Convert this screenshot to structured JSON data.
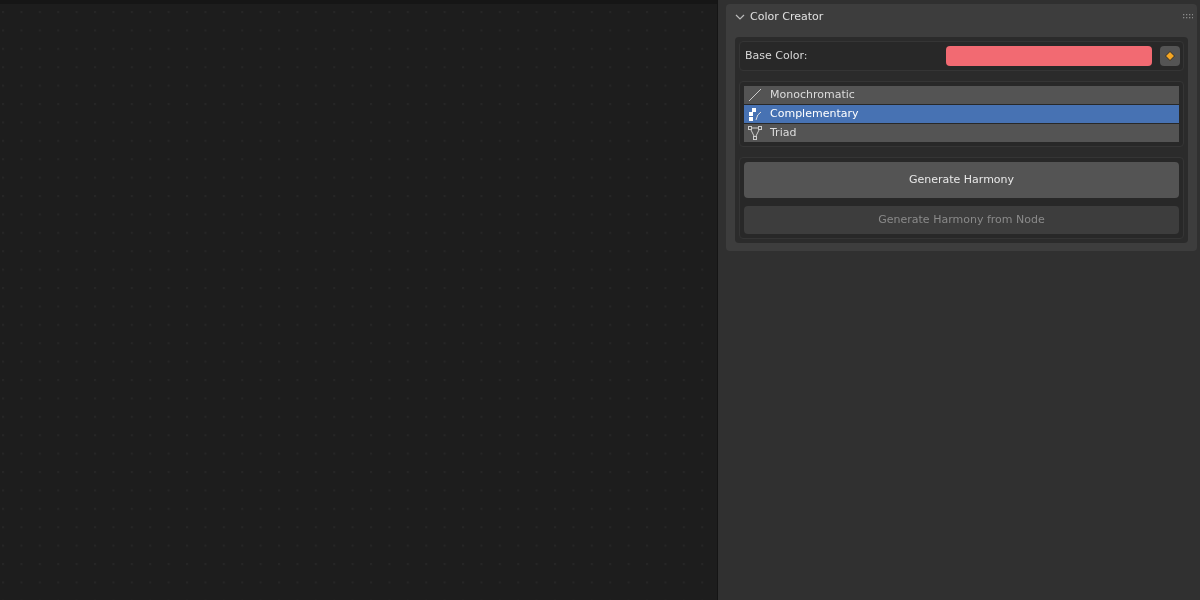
{
  "panel": {
    "title": "Color Creator",
    "expanded": true
  },
  "base_color": {
    "label": "Base Color:",
    "color": "#f26a72"
  },
  "harmonies": [
    {
      "kind": "line",
      "label": "Monochromatic",
      "selected": false
    },
    {
      "kind": "squares",
      "label": "Complementary",
      "selected": true
    },
    {
      "kind": "triangle",
      "label": "Triad",
      "selected": false
    }
  ],
  "buttons": [
    {
      "label": "Generate Harmony",
      "disabled": false
    },
    {
      "label": "Generate Harmony from Node",
      "disabled": true
    }
  ]
}
